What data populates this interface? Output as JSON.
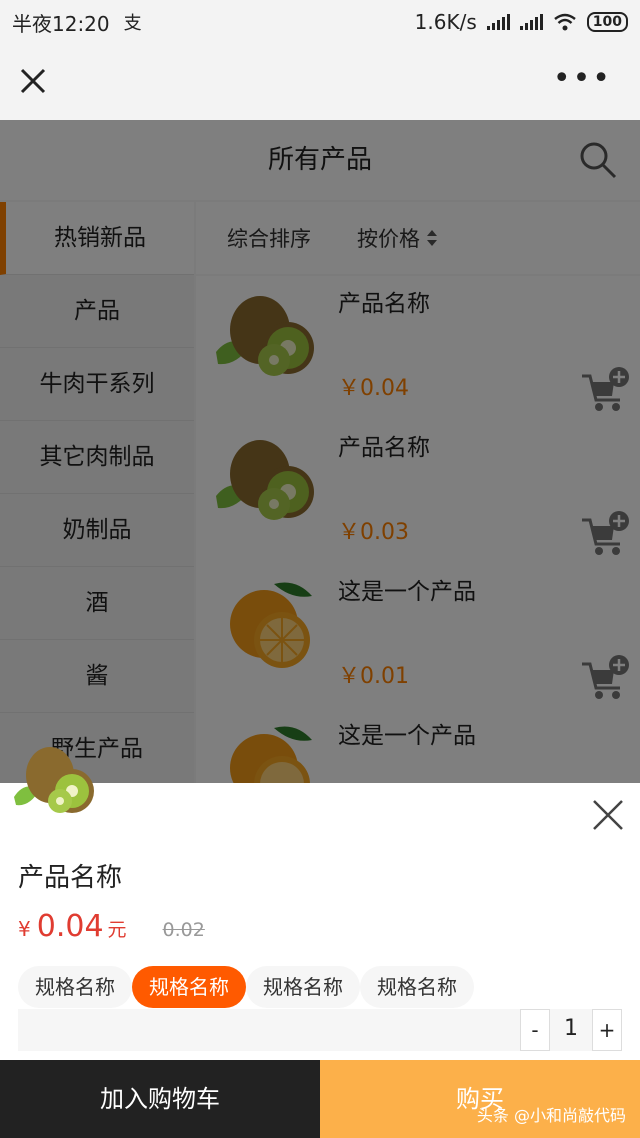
{
  "status": {
    "time": "半夜12:20",
    "speed": "1.6K/s",
    "battery": "100",
    "app_glyph": "支"
  },
  "page_title": "所有产品",
  "sidebar": {
    "items": [
      {
        "label": "热销新品",
        "active": true
      },
      {
        "label": "产品"
      },
      {
        "label": "牛肉干系列"
      },
      {
        "label": "其它肉制品"
      },
      {
        "label": "奶制品"
      },
      {
        "label": "酒"
      },
      {
        "label": "酱"
      },
      {
        "label": "野生产品"
      }
    ]
  },
  "sort": {
    "comprehensive": "综合排序",
    "by_price": "按价格"
  },
  "products": [
    {
      "name": "产品名称",
      "price": "￥0.04",
      "image": "kiwi"
    },
    {
      "name": "产品名称",
      "price": "￥0.03",
      "image": "kiwi"
    },
    {
      "name": "这是一个产品",
      "price": "￥0.01",
      "image": "orange"
    },
    {
      "name": "这是一个产品",
      "price": "",
      "image": "orange"
    }
  ],
  "sheet": {
    "product_name": "产品名称",
    "currency": "¥",
    "price": "0.04",
    "unit": "元",
    "old_price": "0.02",
    "specs": [
      "规格名称",
      "规格名称",
      "规格名称",
      "规格名称"
    ],
    "active_spec": 1,
    "qty_minus": "-",
    "qty": "1",
    "qty_plus": "+"
  },
  "footer": {
    "add_to_cart": "加入购物车",
    "buy": "购买"
  },
  "watermark": "头条 @小和尚敲代码",
  "colors": {
    "accent": "#ff8000",
    "price_red": "#e03c31",
    "spec_active": "#ff5a00",
    "buy_bg": "#fcb04a"
  }
}
